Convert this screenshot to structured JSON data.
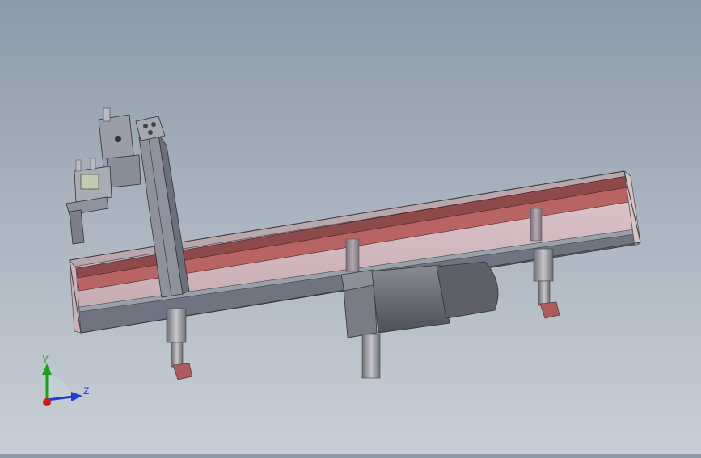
{
  "viewport": {
    "background_top": "#8e9aa8",
    "background_bottom": "#c9cfd6"
  },
  "triad": {
    "x_label": "",
    "y_label": "Y",
    "z_label": "Z",
    "colors": {
      "x": "#d11a1a",
      "y": "#1aa11a",
      "z": "#1a3fd1"
    }
  },
  "model": {
    "parts": [
      "conveyor-frame",
      "conveyor-belt",
      "vertical-column",
      "gripper-head",
      "motor",
      "legs"
    ],
    "colors": {
      "frame": "#6f7480",
      "belt": "#b46262",
      "belt_top": "#8e4a4a",
      "inner": "#d8b8bf",
      "motor": "#6e7079",
      "leg": "#9a9aa2",
      "foot": "#b05b5b"
    }
  }
}
